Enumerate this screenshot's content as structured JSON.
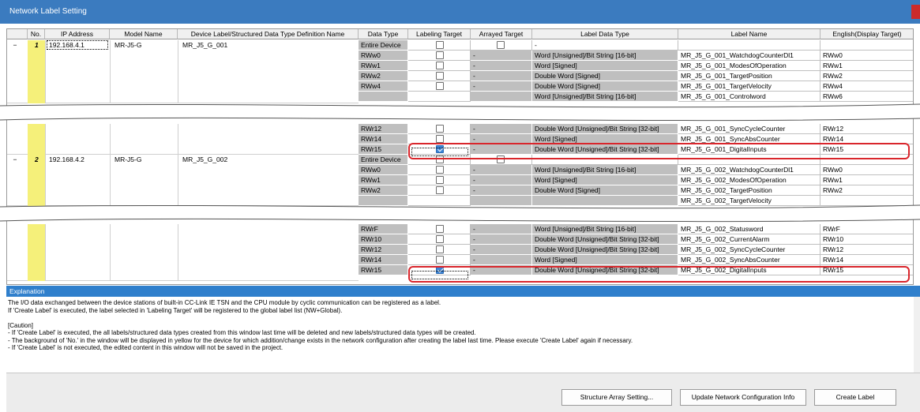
{
  "window": {
    "title": "Network Label Setting"
  },
  "columns": [
    "No.",
    "IP Address",
    "Model Name",
    "Device Label/Structured Data Type Definition Name",
    "Data Type",
    "Labeling Target",
    "Arrayed Target",
    "Label Data Type",
    "Label Name",
    "English(Display Target)"
  ],
  "devices": [
    {
      "expander": "−",
      "no": "1",
      "ip": "192.168.4.1",
      "model": "MR-J5-G",
      "label": "MR_J5_G_001"
    },
    {
      "expander": "−",
      "no": "2",
      "ip": "192.168.4.2",
      "model": "MR-J5-G",
      "label": "MR_J5_G_002"
    }
  ],
  "block1": [
    {
      "data_type": "Entire Device",
      "labeling": false,
      "arrayed": false,
      "arrayed_shown": true,
      "ldt": "-",
      "name": "",
      "eng": ""
    },
    {
      "data_type": "RWw0",
      "labeling": false,
      "arrayed_text": "-",
      "ldt": "Word [Unsigned]/Bit String [16-bit]",
      "name": "MR_J5_G_001_WatchdogCounterDl1",
      "eng": "RWw0"
    },
    {
      "data_type": "RWw1",
      "labeling": false,
      "arrayed_text": "-",
      "ldt": "Word [Signed]",
      "name": "MR_J5_G_001_ModesOfOperation",
      "eng": "RWw1"
    },
    {
      "data_type": "RWw2",
      "labeling": false,
      "arrayed_text": "-",
      "ldt": "Double Word [Signed]",
      "name": "MR_J5_G_001_TargetPosition",
      "eng": "RWw2"
    },
    {
      "data_type": "RWw4",
      "labeling": false,
      "arrayed_text": "-",
      "ldt": "Double Word [Signed]",
      "name": "MR_J5_G_001_TargetVelocity",
      "eng": "RWw4"
    },
    {
      "data_type": "",
      "labeling": null,
      "arrayed_text": "",
      "ldt": "Word [Unsigned]/Bit String [16-bit]",
      "name": "MR_J5_G_001_Controlword",
      "eng": "RWw6"
    }
  ],
  "block2": [
    {
      "data_type": "RWr12",
      "labeling": false,
      "arrayed_text": "-",
      "ldt": "Double Word [Unsigned]/Bit String [32-bit]",
      "name": "MR_J5_G_001_SyncCycleCounter",
      "eng": "RWr12"
    },
    {
      "data_type": "RWr14",
      "labeling": false,
      "arrayed_text": "-",
      "ldt": "Word [Signed]",
      "name": "MR_J5_G_001_SyncAbsCounter",
      "eng": "RWr14"
    },
    {
      "data_type": "RWr15",
      "labeling": true,
      "arrayed_text": "-",
      "ldt": "Double Word [Unsigned]/Bit String [32-bit]",
      "name": "MR_J5_G_001_DigitalInputs",
      "eng": "RWr15"
    },
    {
      "data_type": "Entire Device",
      "labeling": false,
      "arrayed": false,
      "arrayed_shown": true,
      "ldt": "",
      "name": "",
      "eng": ""
    },
    {
      "data_type": "RWw0",
      "labeling": false,
      "arrayed_text": "-",
      "ldt": "Word [Unsigned]/Bit String [16-bit]",
      "name": "MR_J5_G_002_WatchdogCounterDl1",
      "eng": "RWw0"
    },
    {
      "data_type": "RWw1",
      "labeling": false,
      "arrayed_text": "-",
      "ldt": "Word [Signed]",
      "name": "MR_J5_G_002_ModesOfOperation",
      "eng": "RWw1"
    },
    {
      "data_type": "RWw2",
      "labeling": false,
      "arrayed_text": "-",
      "ldt": "Double Word [Signed]",
      "name": "MR_J5_G_002_TargetPosition",
      "eng": "RWw2"
    },
    {
      "data_type": "",
      "labeling": null,
      "arrayed_text": "",
      "ldt": "",
      "name": "MR_J5_G_002_TargetVelocity",
      "eng": ""
    }
  ],
  "block3": [
    {
      "data_type": "RWrF",
      "labeling": false,
      "arrayed_text": "-",
      "ldt": "Word [Unsigned]/Bit String [16-bit]",
      "name": "MR_J5_G_002_Statusword",
      "eng": "RWrF"
    },
    {
      "data_type": "RWr10",
      "labeling": false,
      "arrayed_text": "-",
      "ldt": "Double Word [Unsigned]/Bit String [32-bit]",
      "name": "MR_J5_G_002_CurrentAlarm",
      "eng": "RWr10"
    },
    {
      "data_type": "RWr12",
      "labeling": false,
      "arrayed_text": "-",
      "ldt": "Double Word [Unsigned]/Bit String [32-bit]",
      "name": "MR_J5_G_002_SyncCycleCounter",
      "eng": "RWr12"
    },
    {
      "data_type": "RWr14",
      "labeling": false,
      "arrayed_text": "-",
      "ldt": "Word [Signed]",
      "name": "MR_J5_G_002_SyncAbsCounter",
      "eng": "RWr14"
    },
    {
      "data_type": "RWr15",
      "labeling": true,
      "arrayed_text": "-",
      "ldt": "Double Word [Unsigned]/Bit String [32-bit]",
      "name": "MR_J5_G_002_DigitalInputs",
      "eng": "RWr15"
    }
  ],
  "explanation": {
    "title": "Explanation",
    "lines": [
      "The I/O data exchanged between the device stations of built-in CC-Link IE TSN and the CPU module by cyclic communication can be registered as a label.",
      "If 'Create Label' is executed, the label selected in 'Labeling Target' will be registered to the global label list (NW+Global).",
      "",
      "[Caution]",
      "- If 'Create Label' is executed, the all labels/structured data types created from this window last time will be deleted and new labels/structured data types will be created.",
      "- The background of 'No.' in the window will be displayed in yellow for the device for which addition/change exists in the network configuration after creating the label last time. Please execute 'Create Label' again if necessary.",
      "- If 'Create Label' is not executed, the edited content in this window will not be saved in the project."
    ]
  },
  "buttons": {
    "structure": "Structure Array Setting...",
    "update": "Update Network Configuration Info",
    "create": "Create Label"
  },
  "colors": {
    "titlebar": "#3b7bbf",
    "highlight": "#d9262c",
    "no_changed": "#f5f07a",
    "checked": "#3d85d6"
  }
}
